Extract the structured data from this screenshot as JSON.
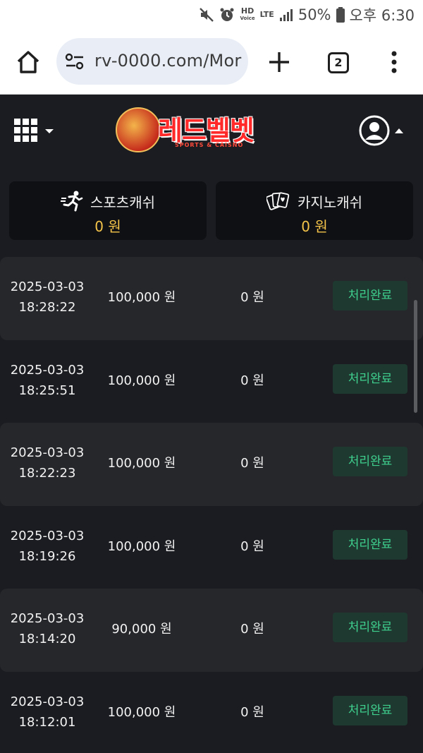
{
  "status_bar": {
    "hd_label": "HD",
    "voice_label": "Voice",
    "lte_label": "LTE",
    "battery_percent": "50%",
    "time": "오후 6:30"
  },
  "browser": {
    "url": "rv-0000.com/Mor",
    "tab_count": "2"
  },
  "site": {
    "logo_title": "레드벨벳",
    "logo_subtitle": "SPORTS & CAISNO"
  },
  "balances": {
    "sports": {
      "label": "스포츠캐쉬",
      "value": "0 원"
    },
    "casino": {
      "label": "카지노캐쉬",
      "value": "0 원"
    }
  },
  "transactions": [
    {
      "date": "2025-03-03",
      "time": "18:28:22",
      "amount": "100,000 원",
      "bonus": "0 원",
      "status": "처리완료"
    },
    {
      "date": "2025-03-03",
      "time": "18:25:51",
      "amount": "100,000 원",
      "bonus": "0 원",
      "status": "처리완료"
    },
    {
      "date": "2025-03-03",
      "time": "18:22:23",
      "amount": "100,000 원",
      "bonus": "0 원",
      "status": "처리완료"
    },
    {
      "date": "2025-03-03",
      "time": "18:19:26",
      "amount": "100,000 원",
      "bonus": "0 원",
      "status": "처리완료"
    },
    {
      "date": "2025-03-03",
      "time": "18:14:20",
      "amount": "90,000 원",
      "bonus": "0 원",
      "status": "처리완료"
    },
    {
      "date": "2025-03-03",
      "time": "18:12:01",
      "amount": "100,000 원",
      "bonus": "0 원",
      "status": "처리완료"
    }
  ],
  "colors": {
    "background": "#1b1c21",
    "row_alt": "#26272b",
    "gold": "#f4c44a",
    "status_green": "#3fcf8e",
    "status_bg": "#1e3a30",
    "brand_red": "#ff2929"
  }
}
